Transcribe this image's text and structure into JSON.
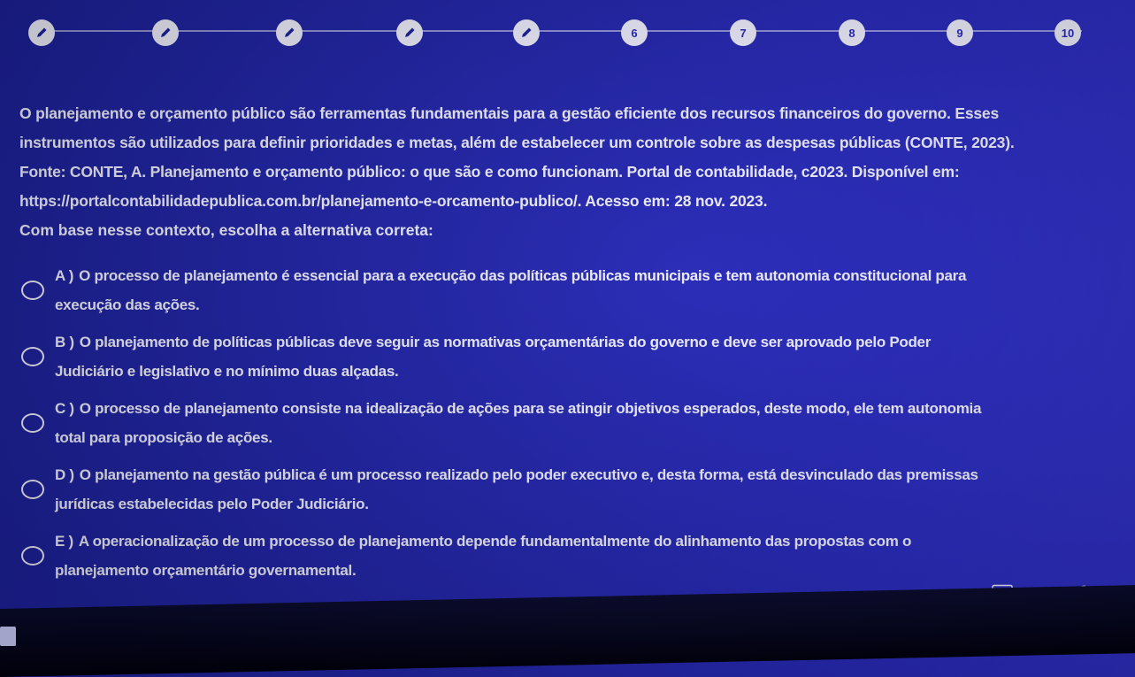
{
  "steps": [
    {
      "label": "",
      "state": "done"
    },
    {
      "label": "",
      "state": "done"
    },
    {
      "label": "",
      "state": "done"
    },
    {
      "label": "",
      "state": "done"
    },
    {
      "label": "",
      "state": "done"
    },
    {
      "label": "6",
      "state": "todo"
    },
    {
      "label": "7",
      "state": "todo"
    },
    {
      "label": "8",
      "state": "todo"
    },
    {
      "label": "9",
      "state": "todo"
    },
    {
      "label": "10",
      "state": "todo"
    }
  ],
  "context": {
    "line1": "O planejamento e orçamento público são ferramentas fundamentais para a gestão eficiente dos recursos financeiros do governo. Esses",
    "line2": "instrumentos são utilizados para definir prioridades e metas, além de estabelecer um controle sobre as despesas públicas (CONTE, 2023).",
    "line3": "Fonte: CONTE, A. Planejamento e orçamento público: o que são e como funcionam. Portal de contabilidade, c2023. Disponível em:",
    "line4": "https://portalcontabilidadepublica.com.br/planejamento-e-orcamento-publico/. Acesso em: 28 nov. 2023.",
    "question": "Com base nesse contexto, escolha a alternativa correta:"
  },
  "options": [
    {
      "letter": "A )",
      "line1": "O processo de planejamento é essencial para a execução das políticas públicas municipais e tem autonomia constitucional para",
      "line2": "execução das ações."
    },
    {
      "letter": "B )",
      "line1": "O planejamento de políticas públicas deve seguir as normativas orçamentárias do governo e deve ser aprovado pelo Poder",
      "line2": "Judiciário e legislativo e no mínimo duas alçadas."
    },
    {
      "letter": "C )",
      "line1": "O processo de planejamento consiste na idealização de ações para se atingir objetivos esperados, deste modo, ele tem autonomia",
      "line2": "total para proposição de ações."
    },
    {
      "letter": "D )",
      "line1": "O planejamento na gestão pública é um processo realizado pelo poder executivo e, desta forma, está desvinculado das premissas",
      "line2": "jurídicas estabelecidas pelo Poder Judiciário."
    },
    {
      "letter": "E )",
      "line1": "A operacionalização de um processo de planejamento depende fundamentalmente do alinhamento das propostas com o",
      "line2": "planejamento orçamentário governamental."
    }
  ],
  "colors": {
    "background": "#2528a8",
    "text": "#ffffff"
  }
}
